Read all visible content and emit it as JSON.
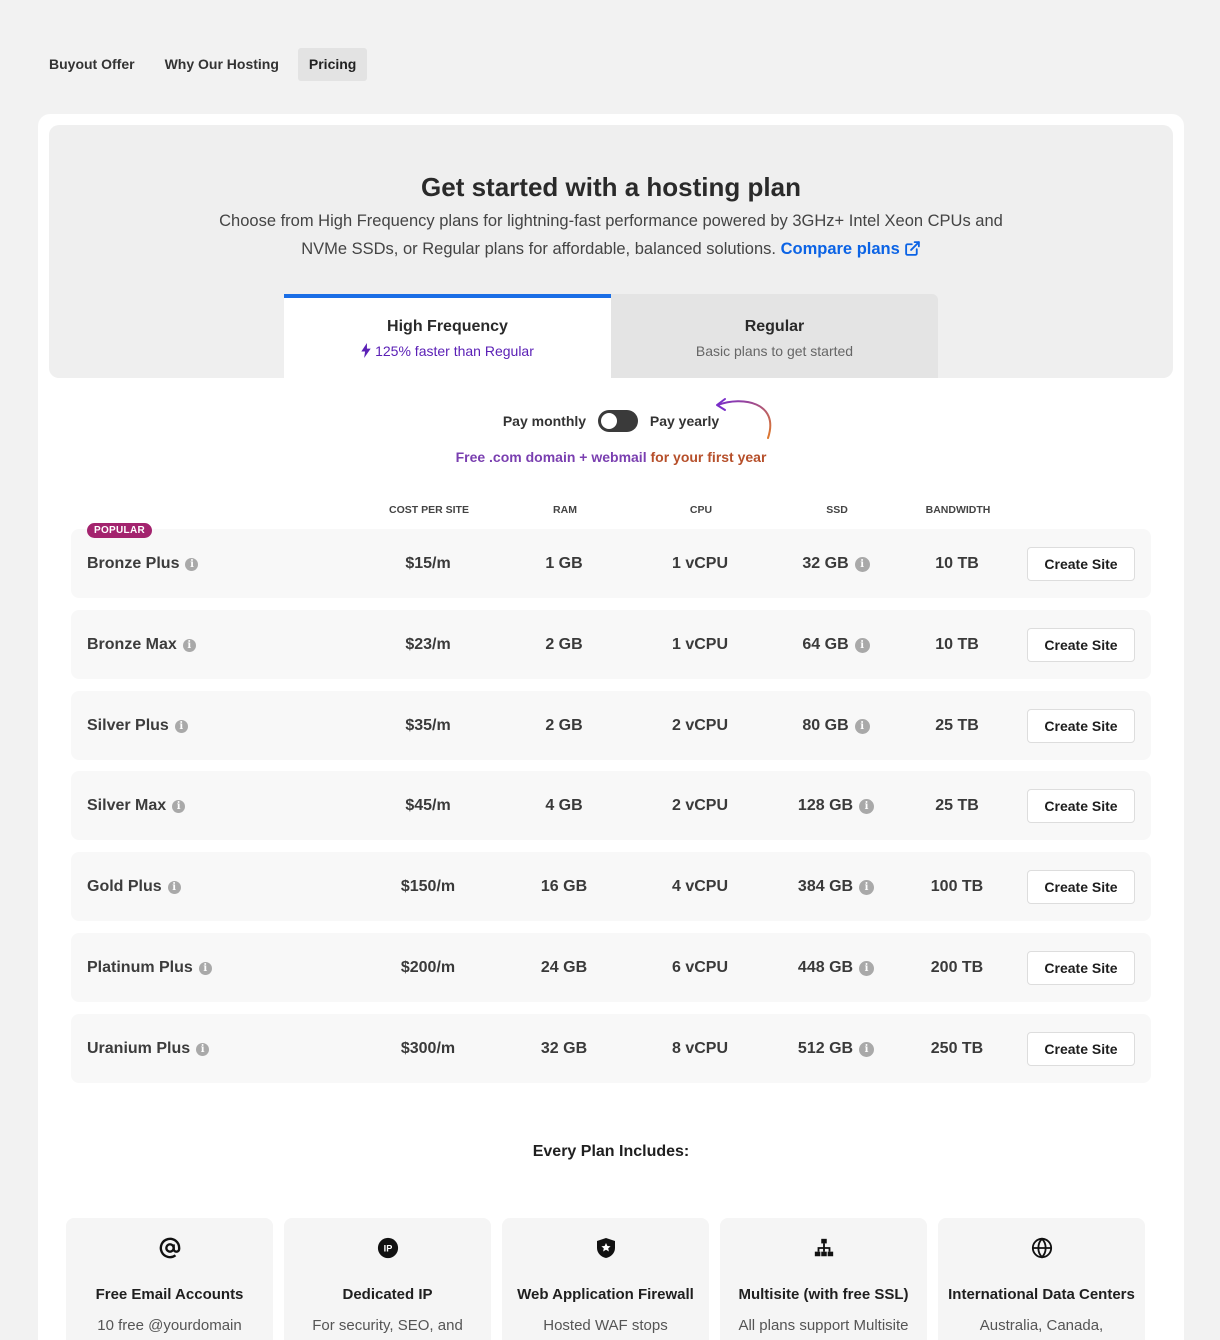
{
  "nav": {
    "tabs": [
      {
        "label": "Buyout Offer",
        "active": false
      },
      {
        "label": "Why Our Hosting",
        "active": false
      },
      {
        "label": "Pricing",
        "active": true
      }
    ]
  },
  "hero": {
    "title": "Get started with a hosting plan",
    "description": "Choose from High Frequency plans for lightning-fast performance powered by 3GHz+ Intel Xeon CPUs and NVMe SSDs, or Regular plans for affordable, balanced solutions.",
    "compare_link": "Compare plans"
  },
  "plan_types": [
    {
      "title": "High Frequency",
      "subtitle": "125% faster than Regular",
      "selected": true
    },
    {
      "title": "Regular",
      "subtitle": "Basic plans to get started",
      "selected": false
    }
  ],
  "billing": {
    "monthly_label": "Pay monthly",
    "yearly_label": "Pay yearly",
    "yearly_selected": false,
    "promo_part1": "Free .com domain + webmail",
    "promo_part2": "for your first year"
  },
  "table": {
    "headers": [
      "COST PER SITE",
      "RAM",
      "CPU",
      "SSD",
      "BANDWIDTH"
    ],
    "popular_badge": "POPULAR",
    "cta_label": "Create Site",
    "rows": [
      {
        "name": "Bronze Plus",
        "cost": "$15/m",
        "ram": "1 GB",
        "cpu": "1 vCPU",
        "ssd": "32 GB",
        "bandwidth": "10 TB"
      },
      {
        "name": "Bronze Max",
        "cost": "$23/m",
        "ram": "2 GB",
        "cpu": "1 vCPU",
        "ssd": "64 GB",
        "bandwidth": "10 TB"
      },
      {
        "name": "Silver Plus",
        "cost": "$35/m",
        "ram": "2 GB",
        "cpu": "2 vCPU",
        "ssd": "80 GB",
        "bandwidth": "25 TB"
      },
      {
        "name": "Silver Max",
        "cost": "$45/m",
        "ram": "4 GB",
        "cpu": "2 vCPU",
        "ssd": "128 GB",
        "bandwidth": "25 TB"
      },
      {
        "name": "Gold Plus",
        "cost": "$150/m",
        "ram": "16 GB",
        "cpu": "4 vCPU",
        "ssd": "384 GB",
        "bandwidth": "100 TB"
      },
      {
        "name": "Platinum Plus",
        "cost": "$200/m",
        "ram": "24 GB",
        "cpu": "6 vCPU",
        "ssd": "448 GB",
        "bandwidth": "200 TB"
      },
      {
        "name": "Uranium Plus",
        "cost": "$300/m",
        "ram": "32 GB",
        "cpu": "8 vCPU",
        "ssd": "512 GB",
        "bandwidth": "250 TB"
      }
    ]
  },
  "includes": {
    "title": "Every Plan Includes:",
    "features": [
      {
        "icon": "at-sign-icon",
        "title": "Free Email Accounts",
        "desc": "10 free @yourdomain"
      },
      {
        "icon": "ip-icon",
        "title": "Dedicated IP",
        "desc": "For security, SEO, and"
      },
      {
        "icon": "shield-icon",
        "title": "Web Application Firewall",
        "desc": "Hosted WAF stops"
      },
      {
        "icon": "sitemap-icon",
        "title": "Multisite (with free SSL)",
        "desc": "All plans support Multisite"
      },
      {
        "icon": "globe-icon",
        "title": "International Data Centers",
        "desc": "Australia, Canada,"
      }
    ]
  },
  "colors": {
    "accent_blue": "#1a6ee6",
    "link_blue": "#0b63e5",
    "purple": "#5b20b6",
    "badge": "#a3236e"
  }
}
